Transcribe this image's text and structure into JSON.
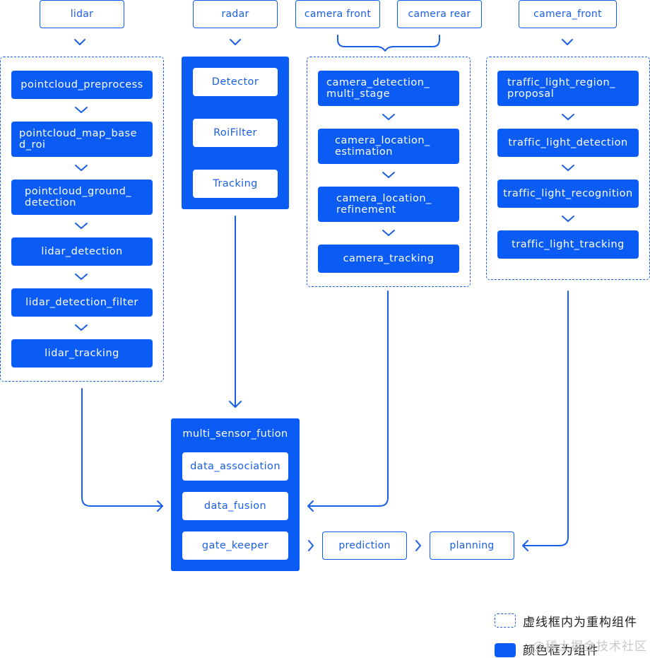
{
  "colors": {
    "primary": "#0a5cf5",
    "text_dark": "#222222",
    "watermark": "#c8c8c8"
  },
  "sources": {
    "lidar": "lidar",
    "radar": "radar",
    "camera_front": "camera front",
    "camera_rear": "camera rear",
    "camera_front_tl": "camera_front"
  },
  "lidar_pipeline": [
    "pointcloud_preprocess",
    "pointcloud_map_base\nd_roi",
    "pointcloud_ground_\ndetection",
    "lidar_detection",
    "lidar_detection_filter",
    "lidar_tracking"
  ],
  "radar_pipeline": [
    "Detector",
    "RoiFilter",
    "Tracking"
  ],
  "camera_pipeline": [
    "camera_detection_\nmulti_stage",
    "camera_location_\nestimation",
    "camera_location_\nrefinement",
    "camera_tracking"
  ],
  "traffic_light_pipeline": [
    "traffic_light_region_\nproposal",
    "traffic_light_detection",
    "traffic_light_recognition",
    "traffic_light_tracking"
  ],
  "fusion": {
    "title": "multi_sensor_fution",
    "items": [
      "data_association",
      "data_fusion",
      "gate_keeper"
    ]
  },
  "downstream": {
    "prediction": "prediction",
    "planning": "planning"
  },
  "legend": {
    "dashed": "虚线框内为重构组件",
    "solid": "颜色框为组件"
  },
  "watermark": "@稀土掘金技术社区"
}
